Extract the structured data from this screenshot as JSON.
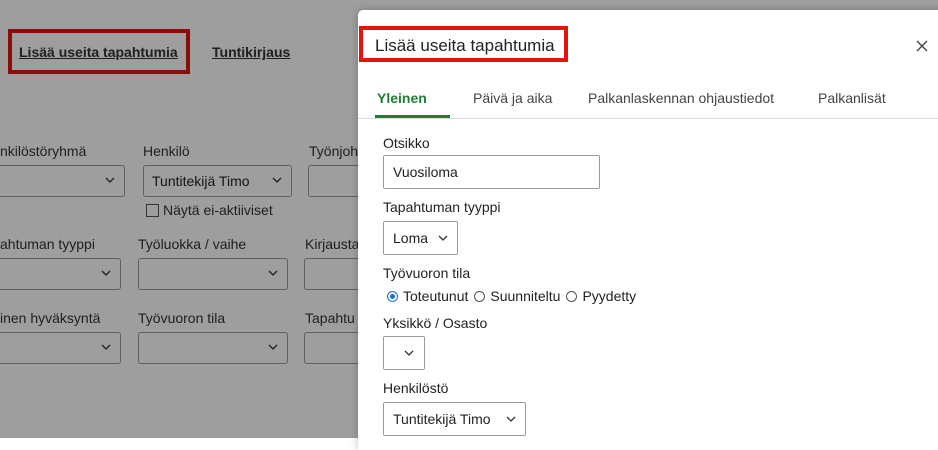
{
  "background": {
    "links": {
      "add_multiple": "Lisää useita tapahtumia",
      "hour_entry": "Tuntikirjaus"
    },
    "filters": {
      "staff_group_label": "nkilöstöryhmä",
      "person_label": "Henkilö",
      "person_value": "Tuntitekijä Timo",
      "supervisor_label": "Työnjoh",
      "show_inactive_label": "Näytä ei-aktiiviset",
      "event_type_label": "ahtuman tyyppi",
      "work_class_label": "Työluokka / vaihe",
      "entry_label": "Kirjausta",
      "approval_label": "inen hyväksyntä",
      "shift_state_label": "Työvuoron tila",
      "event_label": "Tapahtu"
    }
  },
  "modal": {
    "title": "Lisää useita tapahtumia",
    "tabs": [
      {
        "label": "Yleinen",
        "active": true
      },
      {
        "label": "Päivä ja aika",
        "active": false
      },
      {
        "label": "Palkanlaskennan ohjaustiedot",
        "active": false
      },
      {
        "label": "Palkanlisät",
        "active": false
      }
    ],
    "fields": {
      "title_label": "Otsikko",
      "title_value": "Vuosiloma",
      "event_type_label": "Tapahtuman tyyppi",
      "event_type_value": "Loma",
      "shift_state_label": "Työvuoron tila",
      "shift_state_options": [
        "Toteutunut",
        "Suunniteltu",
        "Pyydetty"
      ],
      "shift_state_selected": "Toteutunut",
      "unit_label": "Yksikkö / Osasto",
      "unit_value": "",
      "staff_label": "Henkilöstö",
      "staff_value": "Tuntitekijä Timo"
    }
  },
  "colors": {
    "highlight": "#e3140f",
    "active_tab": "#1e7e34",
    "radio_selected": "#1a6fd6"
  }
}
